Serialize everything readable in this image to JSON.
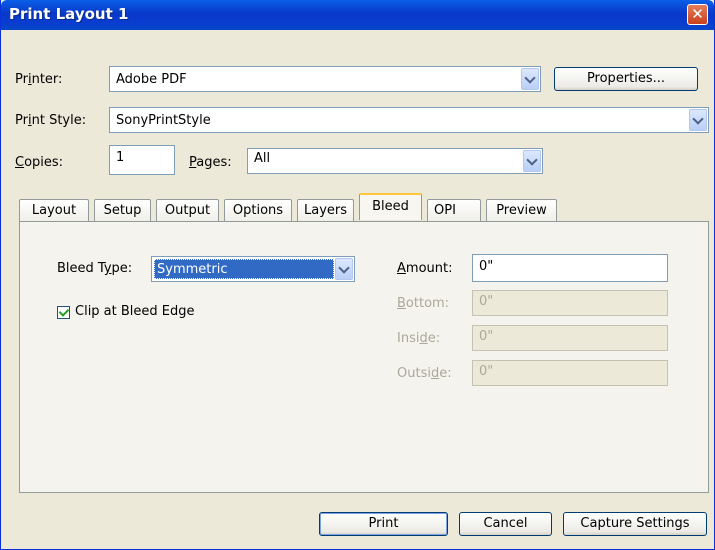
{
  "window": {
    "title": "Print Layout 1",
    "close_glyph": "✕"
  },
  "printer": {
    "label": "Printer:",
    "value": "Adobe PDF",
    "properties_label": "Properties..."
  },
  "print_style": {
    "label": "Print Style:",
    "value": "SonyPrintStyle"
  },
  "copies": {
    "label": "Copies:",
    "value": "1"
  },
  "pages": {
    "label": "Pages:",
    "value": "All"
  },
  "tabs": [
    "Layout",
    "Setup",
    "Output",
    "Options",
    "Layers",
    "Bleed",
    "OPI",
    "Preview"
  ],
  "active_tab": "Bleed",
  "bleed": {
    "type_label": "Bleed Type:",
    "type_value": "Symmetric",
    "clip_label": "Clip at Bleed Edge",
    "clip_checked": true,
    "amount_label": "Amount:",
    "amount_value": "0\"",
    "bottom_label": "Bottom:",
    "bottom_value": "0\"",
    "inside_label": "Inside:",
    "inside_value": "0\"",
    "outside_label": "Outside:",
    "outside_value": "0\""
  },
  "buttons": {
    "print": "Print",
    "cancel": "Cancel",
    "capture": "Capture Settings"
  },
  "colors": {
    "titlebar": "#0a5fe8",
    "dialog_bg": "#ece9d8",
    "selection": "#316ac5",
    "active_tab_accent": "#ffc83c"
  }
}
